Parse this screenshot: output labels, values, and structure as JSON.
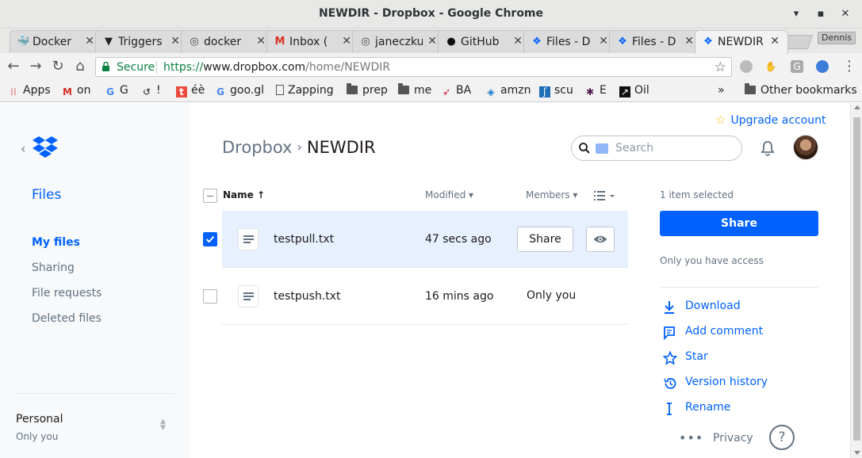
{
  "window": {
    "title": "NEWDIR - Dropbox - Google Chrome",
    "minimize_glyph": "▾",
    "maximize_glyph": "▪",
    "close_glyph": "✕"
  },
  "tabs": [
    {
      "label": "Docker",
      "icon": "docker-whale-icon"
    },
    {
      "label": "Triggers",
      "icon": "funnel-icon"
    },
    {
      "label": "docker",
      "icon": "circle-globe-icon"
    },
    {
      "label": "Inbox (",
      "icon": "gmail-icon"
    },
    {
      "label": "janeczku",
      "icon": "circle-globe-icon"
    },
    {
      "label": "GitHub",
      "icon": "github-icon"
    },
    {
      "label": "Files - D",
      "icon": "dropbox-icon"
    },
    {
      "label": "Files - D",
      "icon": "dropbox-icon"
    },
    {
      "label": "NEWDIR",
      "icon": "dropbox-icon",
      "active": true
    }
  ],
  "profile_chip": "Dennis",
  "omnibox": {
    "secure_label": "Secure",
    "url_scheme": "https://",
    "url_host": "www.dropbox.com",
    "url_path": "/home/NEWDIR"
  },
  "bookmarks": [
    {
      "label": "Apps",
      "icon": "apps-grid-icon"
    },
    {
      "label": "on",
      "icon": "gmail-badge-icon"
    },
    {
      "label": "G",
      "icon": "google-icon"
    },
    {
      "label": "!",
      "icon": "undo-circle-icon"
    },
    {
      "label": "éè",
      "icon": "t-badge-icon"
    },
    {
      "label": "goo.gl",
      "icon": "google-icon"
    },
    {
      "label": "Zapping",
      "icon": "page-icon"
    },
    {
      "label": "prep",
      "icon": "folder-icon"
    },
    {
      "label": "me",
      "icon": "folder-icon"
    },
    {
      "label": "BA",
      "icon": "ba-icon"
    },
    {
      "label": "amzn",
      "icon": "chase-icon"
    },
    {
      "label": "scu",
      "icon": "scu-icon"
    },
    {
      "label": "E",
      "icon": "slack-icon"
    },
    {
      "label": "Oil",
      "icon": "chart-icon"
    }
  ],
  "other_bookmarks": "Other bookmarks",
  "overflow_glyph": "»",
  "sidebar": {
    "section": "Files",
    "items": [
      {
        "label": "My files",
        "active": true
      },
      {
        "label": "Sharing",
        "active": false
      },
      {
        "label": "File requests",
        "active": false
      },
      {
        "label": "Deleted files",
        "active": false
      }
    ],
    "account_name": "Personal",
    "account_sub": "Only you"
  },
  "breadcrumb": {
    "root": "Dropbox",
    "separator": "›",
    "current": "NEWDIR"
  },
  "header": {
    "upgrade": "Upgrade account",
    "search_placeholder": "Search"
  },
  "table": {
    "columns": {
      "name": "Name ↑",
      "modified": "Modified ▾",
      "members": "Members ▾"
    },
    "rows": [
      {
        "name": "testpull.txt",
        "modified": "47 secs ago",
        "members": "",
        "selected": true,
        "share_label": "Share"
      },
      {
        "name": "testpush.txt",
        "modified": "16 mins ago",
        "members": "Only you",
        "selected": false
      }
    ]
  },
  "details": {
    "selected_count": "1 item selected",
    "share_button": "Share",
    "access": "Only you have access",
    "actions": [
      {
        "label": "Download",
        "icon": "download-icon"
      },
      {
        "label": "Add comment",
        "icon": "comment-icon"
      },
      {
        "label": "Star",
        "icon": "star-icon"
      },
      {
        "label": "Version history",
        "icon": "history-icon"
      },
      {
        "label": "Rename",
        "icon": "rename-cursor-icon"
      }
    ],
    "more": "•••",
    "privacy": "Privacy",
    "help": "?"
  },
  "colors": {
    "accent": "#0061fe",
    "selected_row": "#e6f0fe",
    "sidebar_bg": "#f7f9fa",
    "muted_text": "#637282"
  }
}
